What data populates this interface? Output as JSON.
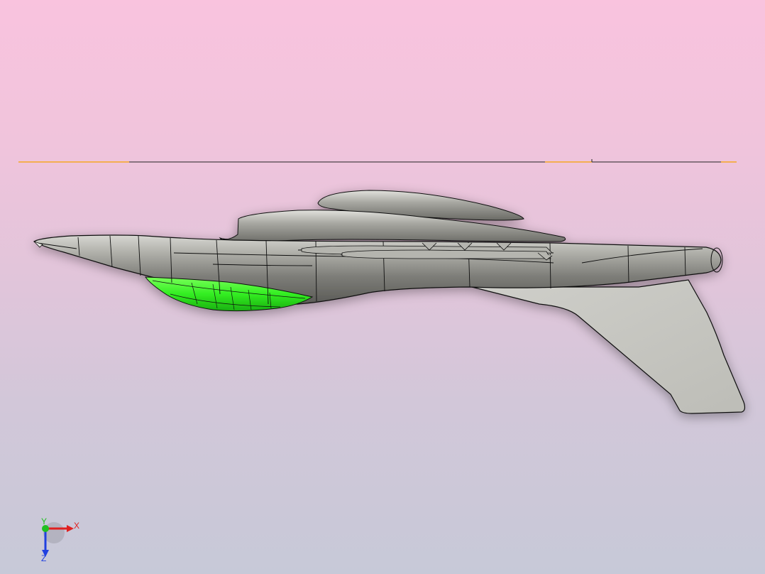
{
  "viewport": {
    "background_top": "#f9c3de",
    "background_bottom": "#c7c9d8"
  },
  "model": {
    "body_color": "#8f8f8a",
    "highlighted_face_color": "#33ee22",
    "fin_color": "#c9c9c3",
    "edge_color": "#111111",
    "datum_line_color": "#222222",
    "datum_line_accent": "#f5a623"
  },
  "triad": {
    "x_label": "X",
    "y_label": "Y",
    "z_label": "Z",
    "x_color": "#e02020",
    "y_color": "#20c020",
    "z_color": "#2040e0"
  }
}
